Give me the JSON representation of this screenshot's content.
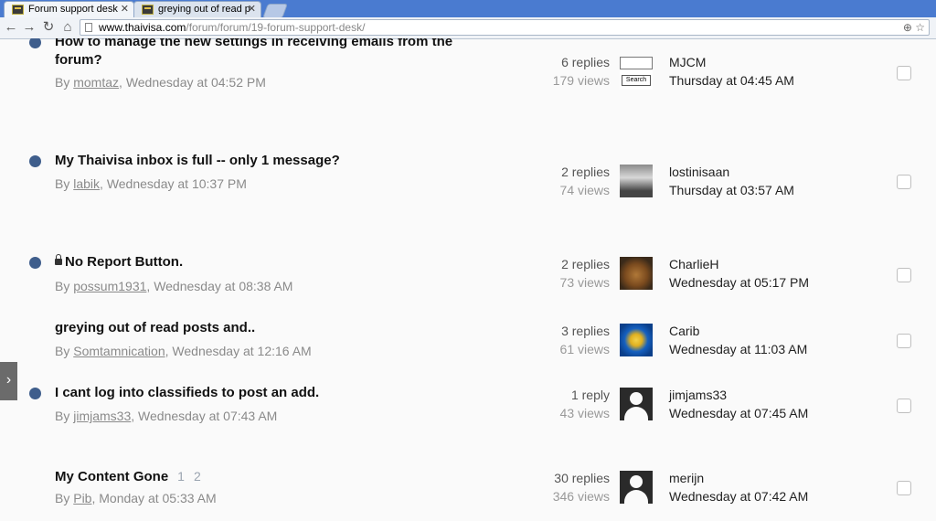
{
  "browser": {
    "tabs": [
      {
        "label": "Forum support desk"
      },
      {
        "label": "greying out of read p"
      }
    ],
    "url_host": "www.thaivisa.com",
    "url_path": "/forum/forum/19-forum-support-desk/"
  },
  "topics": [
    {
      "title": "How to manage the new settings in receiving emails from the forum?",
      "author": "momtaz",
      "date": "Wednesday at 04:52 PM",
      "replies": "6 replies",
      "views": "179 views",
      "last_user": "MJCM",
      "last_date": "Thursday at 04:45 AM",
      "avatar_search_label": "Search",
      "unread": true
    },
    {
      "title": "My Thaivisa inbox is full -- only 1 message?",
      "author": "labik",
      "date": "Wednesday at 10:37 PM",
      "replies": "2 replies",
      "views": "74 views",
      "last_user": "lostinisaan",
      "last_date": "Thursday at 03:57 AM",
      "unread": true
    },
    {
      "title": "No Report Button.",
      "author": "possum1931",
      "date": "Wednesday at 08:38 AM",
      "replies": "2 replies",
      "views": "73 views",
      "last_user": "CharlieH",
      "last_date": "Wednesday at 05:17 PM",
      "unread": true,
      "locked": true
    },
    {
      "title": "greying out of read posts and..",
      "author": "Somtamnication",
      "date": "Wednesday at 12:16 AM",
      "replies": "3 replies",
      "views": "61 views",
      "last_user": "Carib",
      "last_date": "Wednesday at 11:03 AM",
      "unread": false
    },
    {
      "title": "I cant log into classifieds to post an add.",
      "author": "jimjams33",
      "date": "Wednesday at 07:43 AM",
      "replies": "1 reply",
      "views": "43 views",
      "last_user": "jimjams33",
      "last_date": "Wednesday at 07:45 AM",
      "unread": true
    },
    {
      "title": "My Content Gone",
      "author": "Pib",
      "date": "Monday at 05:33 AM",
      "replies": "30 replies",
      "views": "346 views",
      "last_user": "merijn",
      "last_date": "Wednesday at 07:42 AM",
      "unread": false,
      "pages": [
        "1",
        "2"
      ]
    }
  ],
  "meta_prefix": "By ",
  "sidebar_toggle": "›"
}
